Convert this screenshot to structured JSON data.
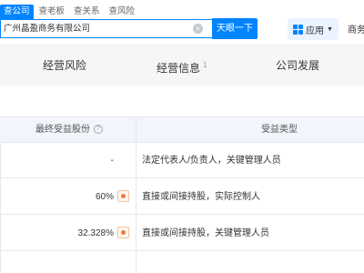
{
  "search": {
    "tabs": [
      "查公司",
      "查老板",
      "查关系",
      "查风险"
    ],
    "query": "广州晶盈商务有限公司",
    "button": "天眼一下",
    "clear_icon": "clear-icon"
  },
  "header": {
    "apps_label": "应用",
    "apps_icon": "grid-icon",
    "biz_label": "商务"
  },
  "nav": {
    "items": [
      {
        "label": "经营风险",
        "count": ""
      },
      {
        "label": "经营信息",
        "count": "1"
      },
      {
        "label": "公司发展",
        "count": ""
      }
    ]
  },
  "table": {
    "headers": {
      "share": "最终受益股份",
      "type": "受益类型"
    },
    "rows": [
      {
        "share": "-",
        "type": "法定代表人/负责人，关键管理人员"
      },
      {
        "share": "60%",
        "type": "直接或间接持股，实际控制人"
      },
      {
        "share": "32.328%",
        "type": "直接或间接持股，关键管理人员"
      }
    ]
  },
  "colors": {
    "accent": "#0084ff",
    "path_icon": "#f07a3c"
  }
}
